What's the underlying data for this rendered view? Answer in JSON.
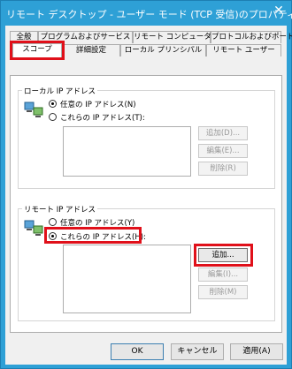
{
  "window": {
    "title": "リモート デスクトップ - ユーザー モード (TCP 受信)のプロパティ",
    "close_glyph": "✕"
  },
  "tabs": {
    "row1": [
      "全般",
      "プログラムおよびサービス",
      "リモート コンピューター",
      "プロトコルおよびポート"
    ],
    "row2": [
      "スコープ",
      "詳細設定",
      "ローカル プリンシパル",
      "リモート ユーザー"
    ],
    "active": "スコープ"
  },
  "local_ip": {
    "heading": "ローカル IP アドレス",
    "option_any": "任意の IP アドレス(N)",
    "option_these": "これらの IP アドレス(T):",
    "selected": "any",
    "buttons": {
      "add": "追加(D)...",
      "edit": "編集(E)...",
      "remove": "削除(R)"
    }
  },
  "remote_ip": {
    "heading": "リモート IP アドレス",
    "option_any": "任意の IP アドレス(Y)",
    "option_these": "これらの IP アドレス(H):",
    "selected": "these",
    "buttons": {
      "add": "追加...",
      "edit": "編集(I)...",
      "remove": "削除(M)"
    }
  },
  "footer": {
    "ok": "OK",
    "cancel": "キャンセル",
    "apply": "適用(A)"
  },
  "colors": {
    "titlebar": "#2ea0d6",
    "highlight": "#e0101a"
  },
  "icons": {
    "network": "network-computers-icon"
  }
}
